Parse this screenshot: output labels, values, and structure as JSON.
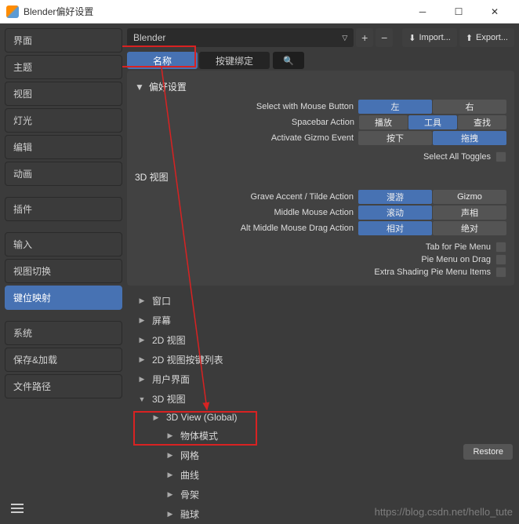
{
  "window": {
    "title": "Blender偏好设置"
  },
  "sidebar": {
    "groups": [
      [
        "界面",
        "主题",
        "视图",
        "灯光",
        "编辑",
        "动画"
      ],
      [
        "插件"
      ],
      [
        "输入",
        "视图切换",
        "键位映射"
      ],
      [
        "系统",
        "保存&加载",
        "文件路径"
      ]
    ],
    "active": "键位映射"
  },
  "topbar": {
    "preset": "Blender",
    "import": "Import...",
    "export": "Export..."
  },
  "tabs": {
    "name": "名称",
    "keybind": "按键绑定",
    "active": "名称"
  },
  "prefs": {
    "header": "偏好设置",
    "rows": {
      "mouseBtn": {
        "label": "Select with Mouse Button",
        "opts": [
          "左",
          "右"
        ],
        "on": 0
      },
      "spacebar": {
        "label": "Spacebar Action",
        "opts": [
          "播放",
          "工具",
          "查找"
        ],
        "on": 1
      },
      "gizmoEvt": {
        "label": "Activate Gizmo Event",
        "opts": [
          "按下",
          "拖拽"
        ],
        "on": 1
      },
      "selAll": {
        "label": "Select All Toggles"
      }
    }
  },
  "view3d": {
    "header": "3D 视图",
    "rows": {
      "grave": {
        "label": "Grave Accent / Tilde Action",
        "opts": [
          "漫游",
          "Gizmo"
        ],
        "on": 0
      },
      "mmb": {
        "label": "Middle Mouse Action",
        "opts": [
          "滚动",
          "声相"
        ],
        "on": 0
      },
      "altmmb": {
        "label": "Alt Middle Mouse Drag Action",
        "opts": [
          "相对",
          "绝对"
        ],
        "on": 0
      }
    },
    "checks": [
      "Tab for Pie Menu",
      "Pie Menu on Drag",
      "Extra Shading Pie Menu Items"
    ]
  },
  "tree": [
    {
      "label": "窗口",
      "open": false
    },
    {
      "label": "屏幕",
      "open": false
    },
    {
      "label": "2D 视图",
      "open": false
    },
    {
      "label": "2D 视图按键列表",
      "open": false
    },
    {
      "label": "用户界面",
      "open": false
    },
    {
      "label": "3D 视图",
      "open": true,
      "children": [
        {
          "label": "3D View (Global)",
          "open": false
        },
        {
          "label": "物体模式",
          "open": false
        },
        {
          "label": "网格",
          "open": false
        },
        {
          "label": "曲线",
          "open": false
        },
        {
          "label": "骨架",
          "open": false
        },
        {
          "label": "融球",
          "open": false
        }
      ]
    }
  ],
  "restore": "Restore",
  "watermark": "https://blog.csdn.net/hello_tute"
}
